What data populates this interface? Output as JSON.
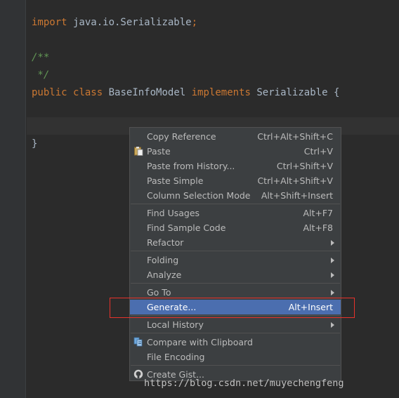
{
  "code": {
    "line1": {
      "kw": "import",
      "rest": " java.io.Serializable",
      "semi": ";"
    },
    "line2": "/**",
    "line3": " */",
    "line4": {
      "kw1": "public",
      "kw2": "class",
      "name": "BaseInfoModel",
      "kw3": "implements",
      "iface": "Serializable",
      "brace": "{"
    },
    "line5": "}"
  },
  "menu": {
    "copy_reference": {
      "label": "Copy Reference",
      "shortcut": "Ctrl+Alt+Shift+C"
    },
    "paste": {
      "label": "Paste",
      "shortcut": "Ctrl+V"
    },
    "paste_history": {
      "label": "Paste from History...",
      "shortcut": "Ctrl+Shift+V"
    },
    "paste_simple": {
      "label": "Paste Simple",
      "shortcut": "Ctrl+Alt+Shift+V"
    },
    "column_selection": {
      "label": "Column Selection Mode",
      "shortcut": "Alt+Shift+Insert"
    },
    "find_usages": {
      "label": "Find Usages",
      "shortcut": "Alt+F7"
    },
    "find_sample": {
      "label": "Find Sample Code",
      "shortcut": "Alt+F8"
    },
    "refactor": {
      "label": "Refactor"
    },
    "folding": {
      "label": "Folding"
    },
    "analyze": {
      "label": "Analyze"
    },
    "go_to": {
      "label": "Go To"
    },
    "generate": {
      "label": "Generate...",
      "shortcut": "Alt+Insert"
    },
    "local_history": {
      "label": "Local History"
    },
    "compare_clipboard": {
      "label": "Compare with Clipboard"
    },
    "file_encoding": {
      "label": "File Encoding"
    },
    "create_gist": {
      "label": "Create Gist..."
    }
  },
  "watermark": "https://blog.csdn.net/muyechengfeng",
  "colors": {
    "background": "#2b2b2b",
    "menu_bg": "#3c3f41",
    "selected": "#4b6eaf",
    "keyword": "#cc7832",
    "comment": "#629755",
    "annotation_box": "#e8322b"
  },
  "icons": {
    "paste": "clipboard-icon",
    "compare": "compare-icon",
    "gist": "github-icon"
  }
}
